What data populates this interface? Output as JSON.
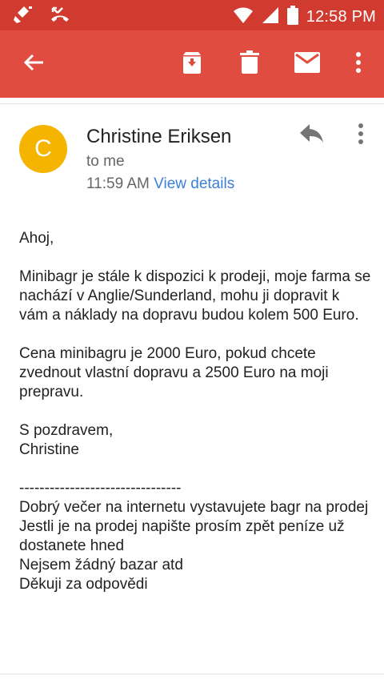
{
  "status_bar": {
    "time": "12:58 PM",
    "icons": [
      "cleaner-icon",
      "missed-call-icon",
      "wifi-icon",
      "signal-icon",
      "battery-icon"
    ]
  },
  "toolbar": {
    "icons": [
      "back-arrow-icon",
      "archive-icon",
      "trash-icon",
      "mail-icon",
      "more-vert-icon"
    ],
    "color": "#e04c3f"
  },
  "email": {
    "avatar_letter": "C",
    "avatar_color": "#f4b400",
    "sender": "Christine Eriksen",
    "recipient": "to me",
    "time": "11:59 AM",
    "view_details": "View details",
    "body": {
      "greeting": "Ahoj,",
      "para1": "Minibagr je stále k dispozici k prodeji, moje farma se nachází v Anglie/Sunderland, mohu ji dopravit k vám a náklady na dopravu budou kolem 500 Euro.",
      "para2": "Cena minibagru je 2000 Euro, pokud chcete zvednout vlastní dopravu a 2500 Euro na moji prepravu.",
      "signoff": "S pozdravem,",
      "signature": "Christine",
      "separator": "--------------------------------",
      "quoted": [
        "Dobrý večer na internetu vystavujete bagr na prodej",
        "Jestli je na prodej napište prosím zpět peníze už dostanete hned",
        "Nejsem žádný bazar atd",
        "Děkuji za odpovědi"
      ]
    }
  }
}
